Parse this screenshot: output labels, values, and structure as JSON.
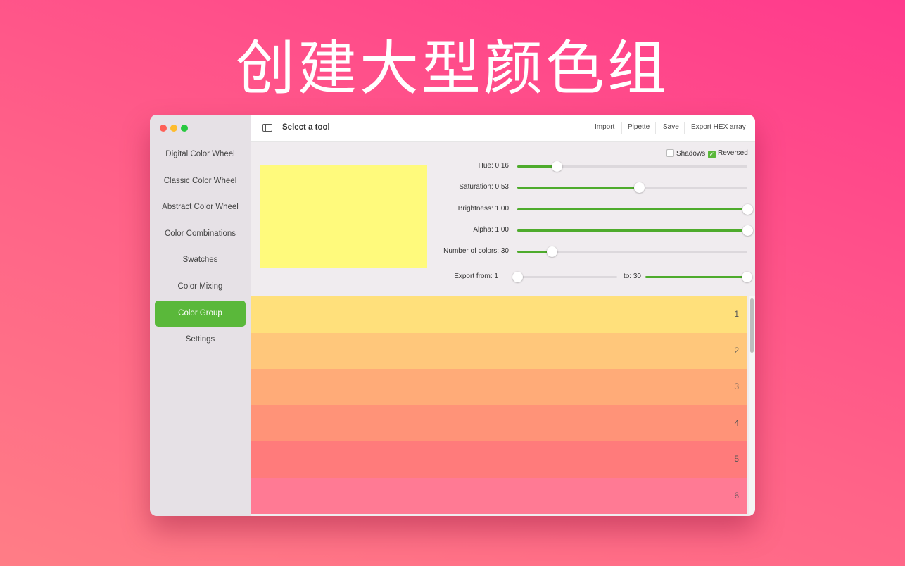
{
  "headline": "创建大型颜色组",
  "window": {
    "title": "Select a tool",
    "toolbar": [
      "Import",
      "Pipette",
      "Save",
      "Export HEX array"
    ],
    "sidebar": [
      "Digital Color Wheel",
      "Classic Color Wheel",
      "Abstract Color Wheel",
      "Color Combinations",
      "Swatches",
      "Color Mixing",
      "Color Group",
      "Settings"
    ],
    "active_item": "Color Group",
    "options": {
      "shadows": {
        "label": "Shadows",
        "checked": false
      },
      "reversed": {
        "label": "Reversed",
        "checked": true
      }
    },
    "preview_color": "#fffa7c",
    "sliders": [
      {
        "label": "Hue: 0.16",
        "value": 0.17
      },
      {
        "label": "Saturation: 0.53",
        "value": 0.53
      },
      {
        "label": "Brightness: 1.00",
        "value": 1.0
      },
      {
        "label": "Alpha: 1.00",
        "value": 1.0
      },
      {
        "label": "Number of colors: 30",
        "value": 0.15
      }
    ],
    "export": {
      "from_label": "Export from: 1",
      "from_value": 0,
      "to_label": "to: 30",
      "to_value": 1
    },
    "accent": "#4eab2c",
    "rows": [
      {
        "n": "1",
        "color": "#ffe07b"
      },
      {
        "n": "2",
        "color": "#ffc77b"
      },
      {
        "n": "3",
        "color": "#ffab78"
      },
      {
        "n": "4",
        "color": "#ff9378"
      },
      {
        "n": "5",
        "color": "#ff7b7b"
      },
      {
        "n": "6",
        "color": "#ff7a94"
      }
    ]
  }
}
